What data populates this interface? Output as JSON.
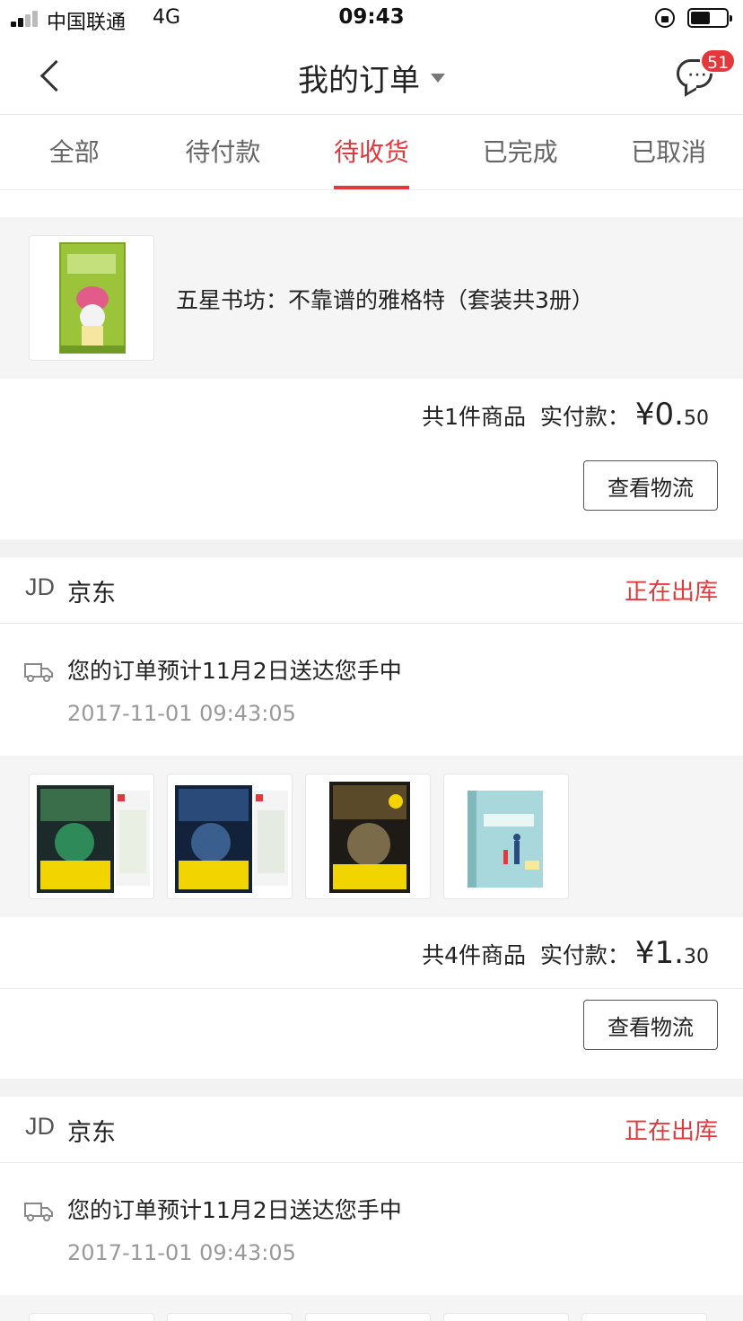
{
  "status_bar": {
    "carrier": "中国联通",
    "network": "4G",
    "time": "09:43",
    "battery_level": 0.55
  },
  "nav": {
    "title": "我的订单",
    "message_count": "51"
  },
  "tabs": [
    {
      "label": "全部"
    },
    {
      "label": "待付款"
    },
    {
      "label": "待收货"
    },
    {
      "label": "已完成"
    },
    {
      "label": "已取消"
    }
  ],
  "active_tab": 2,
  "colors": {
    "accent": "#e4393c"
  },
  "orders": [
    {
      "product_title": "五星书坊：不靠谱的雅格特（套装共3册）",
      "item_count_text": "共1件商品",
      "paid_label": "实付款：",
      "price_int": "¥0.",
      "price_dec": "50",
      "action_label": "查看物流"
    },
    {
      "shop_logo": "JD",
      "shop_name": "京东",
      "status": "正在出库",
      "delivery_message": "您的订单预计11月2日送达您手中",
      "delivery_time": "2017-11-01 09:43:05",
      "item_count_text": "共4件商品",
      "paid_label": "实付款：",
      "price_int": "¥1.",
      "price_dec": "30",
      "action_label": "查看物流"
    },
    {
      "shop_logo": "JD",
      "shop_name": "京东",
      "status": "正在出库",
      "delivery_message": "您的订单预计11月2日送达您手中",
      "delivery_time": "2017-11-01 09:43:05"
    }
  ]
}
